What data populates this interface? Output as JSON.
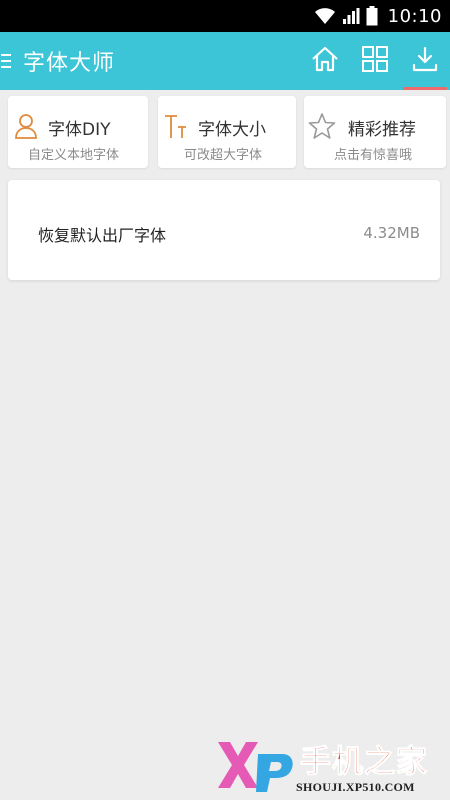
{
  "status_bar": {
    "time": "10:10",
    "icons": [
      "wifi-icon",
      "signal-icon",
      "battery-icon"
    ]
  },
  "app_bar": {
    "title": "字体大师",
    "background": "#3bc5d6",
    "active_indicator_color": "#ef6b6b",
    "actions": [
      {
        "name": "home",
        "icon": "home-icon"
      },
      {
        "name": "grid",
        "icon": "grid-icon"
      },
      {
        "name": "download",
        "icon": "download-icon",
        "active": true
      }
    ]
  },
  "features": [
    {
      "title": "字体DIY",
      "subtitle": "自定义本地字体",
      "icon": "user-icon",
      "icon_color": "#e08a3c"
    },
    {
      "title": "字体大小",
      "subtitle": "可改超大字体",
      "icon": "text-size-icon",
      "icon_color": "#e08a3c"
    },
    {
      "title": "精彩推荐",
      "subtitle": "点击有惊喜哦",
      "icon": "star-icon",
      "icon_color": "#999999"
    }
  ],
  "font_list": [
    {
      "name": "恢复默认出厂字体",
      "size": "4.32MB"
    }
  ],
  "watermark": {
    "logo": "XP",
    "text": "手机之家",
    "url": "SHOUJI.XP510.COM"
  }
}
